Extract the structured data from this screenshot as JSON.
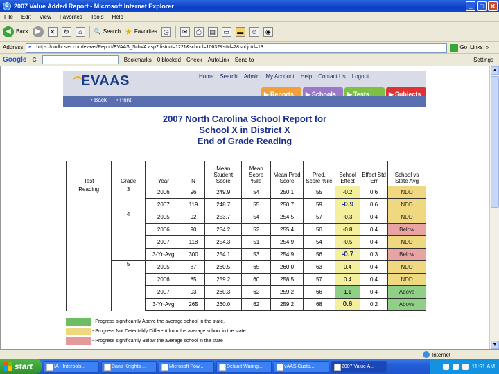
{
  "window": {
    "title": "2007 Value Added Report - Microsoft Internet Explorer"
  },
  "menu": [
    "File",
    "Edit",
    "View",
    "Favorites",
    "Tools",
    "Help"
  ],
  "toolbar": {
    "back": "Back",
    "search": "Search",
    "favorites": "Favorites"
  },
  "address": {
    "label": "Address",
    "url": "https://nodbl.sas.com/evaas/Report/EVAAS_SchVA.asp?district=1221&school=1063?&sttd=2&subjctd=13",
    "go": "Go",
    "links": "Links"
  },
  "googlebar": {
    "logo": "Google",
    "g_label": "G",
    "bookmarks": "Bookmarks",
    "blocked": "0 blocked",
    "check": "Check",
    "autolink": "AutoLink",
    "send_to": "Send to",
    "settings": "Settings"
  },
  "evaas": {
    "logo": "EVAAS",
    "nav": [
      "Home",
      "Search",
      "Admin",
      "My Account",
      "Help",
      "Contact Us",
      "Logout"
    ],
    "subnav": [
      "Back",
      "Print"
    ],
    "tabs": [
      "Reports",
      "Schools",
      "Tests",
      "Subjects"
    ],
    "colors": {
      "reports": "#f0a03a",
      "schools": "#9a7ac8",
      "tests": "#7ec044",
      "subjects": "#dd3333"
    }
  },
  "report": {
    "title_line1": "2007 North Carolina School Report for",
    "title_line2": "School X in District X",
    "title_line3": "End of Grade Reading"
  },
  "table": {
    "headers": [
      "Test",
      "Grade",
      "Year",
      "N",
      "Mean Student Score",
      "Mean Score %ile",
      "Mean Pred Score",
      "Pred. Score %ile",
      "School Effect",
      "Effect Std Err",
      "School vs State Avg"
    ],
    "rows": [
      {
        "test": "Reading",
        "grade": "3",
        "year": "2006",
        "n": "96",
        "mean_score": "249.9",
        "mean_pct": "54",
        "mean_pred": "250.1",
        "pred_pct": "55",
        "effect": "-0.2",
        "stderr": "0.6",
        "status": "NDD",
        "status_class": "nd",
        "effect_class": ""
      },
      {
        "test": "",
        "grade": "",
        "year": "2007",
        "n": "119",
        "mean_score": "248.7",
        "mean_pct": "55",
        "mean_pred": "250.7",
        "pred_pct": "59",
        "effect": "-0.9",
        "stderr": "0.6",
        "status": "NDD",
        "status_class": "nd",
        "effect_class": "big"
      },
      {
        "test": "",
        "grade": "4",
        "year": "2005",
        "n": "92",
        "mean_score": "253.7",
        "mean_pct": "54",
        "mean_pred": "254.5",
        "pred_pct": "57",
        "effect": "-0.3",
        "stderr": "0.4",
        "status": "NDD",
        "status_class": "nd",
        "effect_class": ""
      },
      {
        "test": "",
        "grade": "",
        "year": "2006",
        "n": "90",
        "mean_score": "254.2",
        "mean_pct": "52",
        "mean_pred": "255.4",
        "pred_pct": "50",
        "effect": "-0.8",
        "stderr": "0.4",
        "status": "Below",
        "status_class": "below",
        "effect_class": ""
      },
      {
        "test": "",
        "grade": "",
        "year": "2007",
        "n": "118",
        "mean_score": "254.3",
        "mean_pct": "51",
        "mean_pred": "254.9",
        "pred_pct": "54",
        "effect": "-0.5",
        "stderr": "0.4",
        "status": "NDD",
        "status_class": "nd",
        "effect_class": ""
      },
      {
        "test": "",
        "grade": "",
        "year": "3-Yr-Avg",
        "n": "300",
        "mean_score": "254.1",
        "mean_pct": "53",
        "mean_pred": "254.9",
        "pred_pct": "56",
        "effect": "-0.7",
        "stderr": "0.3",
        "status": "Below",
        "status_class": "below",
        "effect_class": "big"
      },
      {
        "test": "",
        "grade": "5",
        "year": "2005",
        "n": "87",
        "mean_score": "260.5",
        "mean_pct": "65",
        "mean_pred": "260.0",
        "pred_pct": "63",
        "effect": "0.4",
        "stderr": "0.4",
        "status": "NDD",
        "status_class": "nd",
        "effect_class": ""
      },
      {
        "test": "",
        "grade": "",
        "year": "2006",
        "n": "85",
        "mean_score": "259.2",
        "mean_pct": "60",
        "mean_pred": "258.5",
        "pred_pct": "57",
        "effect": "0.4",
        "stderr": "0.4",
        "status": "NDD",
        "status_class": "nd",
        "effect_class": ""
      },
      {
        "test": "",
        "grade": "",
        "year": "2007",
        "n": "93",
        "mean_score": "260.3",
        "mean_pct": "62",
        "mean_pred": "259.2",
        "pred_pct": "66",
        "effect": "1.1",
        "stderr": "0.4",
        "status": "Above",
        "status_class": "above",
        "effect_class": "green"
      },
      {
        "test": "",
        "grade": "",
        "year": "3-Yr-Avg",
        "n": "265",
        "mean_score": "260.0",
        "mean_pct": "62",
        "mean_pred": "259.2",
        "pred_pct": "68",
        "effect": "0.6",
        "stderr": "0.2",
        "status": "Above",
        "status_class": "above",
        "effect_class": "big"
      }
    ]
  },
  "legend": [
    {
      "color": "#6cbd63",
      "text": "- Progress significantly Above the average school in the state."
    },
    {
      "color": "#f0d880",
      "text": "- Progress Not Detectably Different from the average school in the state"
    },
    {
      "color": "#e49a9a",
      "text": "- Progress significantly Below the average school in the state"
    }
  ],
  "status": {
    "zone": "Internet"
  },
  "taskbar": {
    "start": "start",
    "tasks": [
      "IA - Interpols...",
      "Dana Knights ...",
      "Microsoft Pow...",
      "Default Waring...",
      "vAAS Custo...",
      "2007 Value A..."
    ],
    "time": "11:51 AM"
  }
}
